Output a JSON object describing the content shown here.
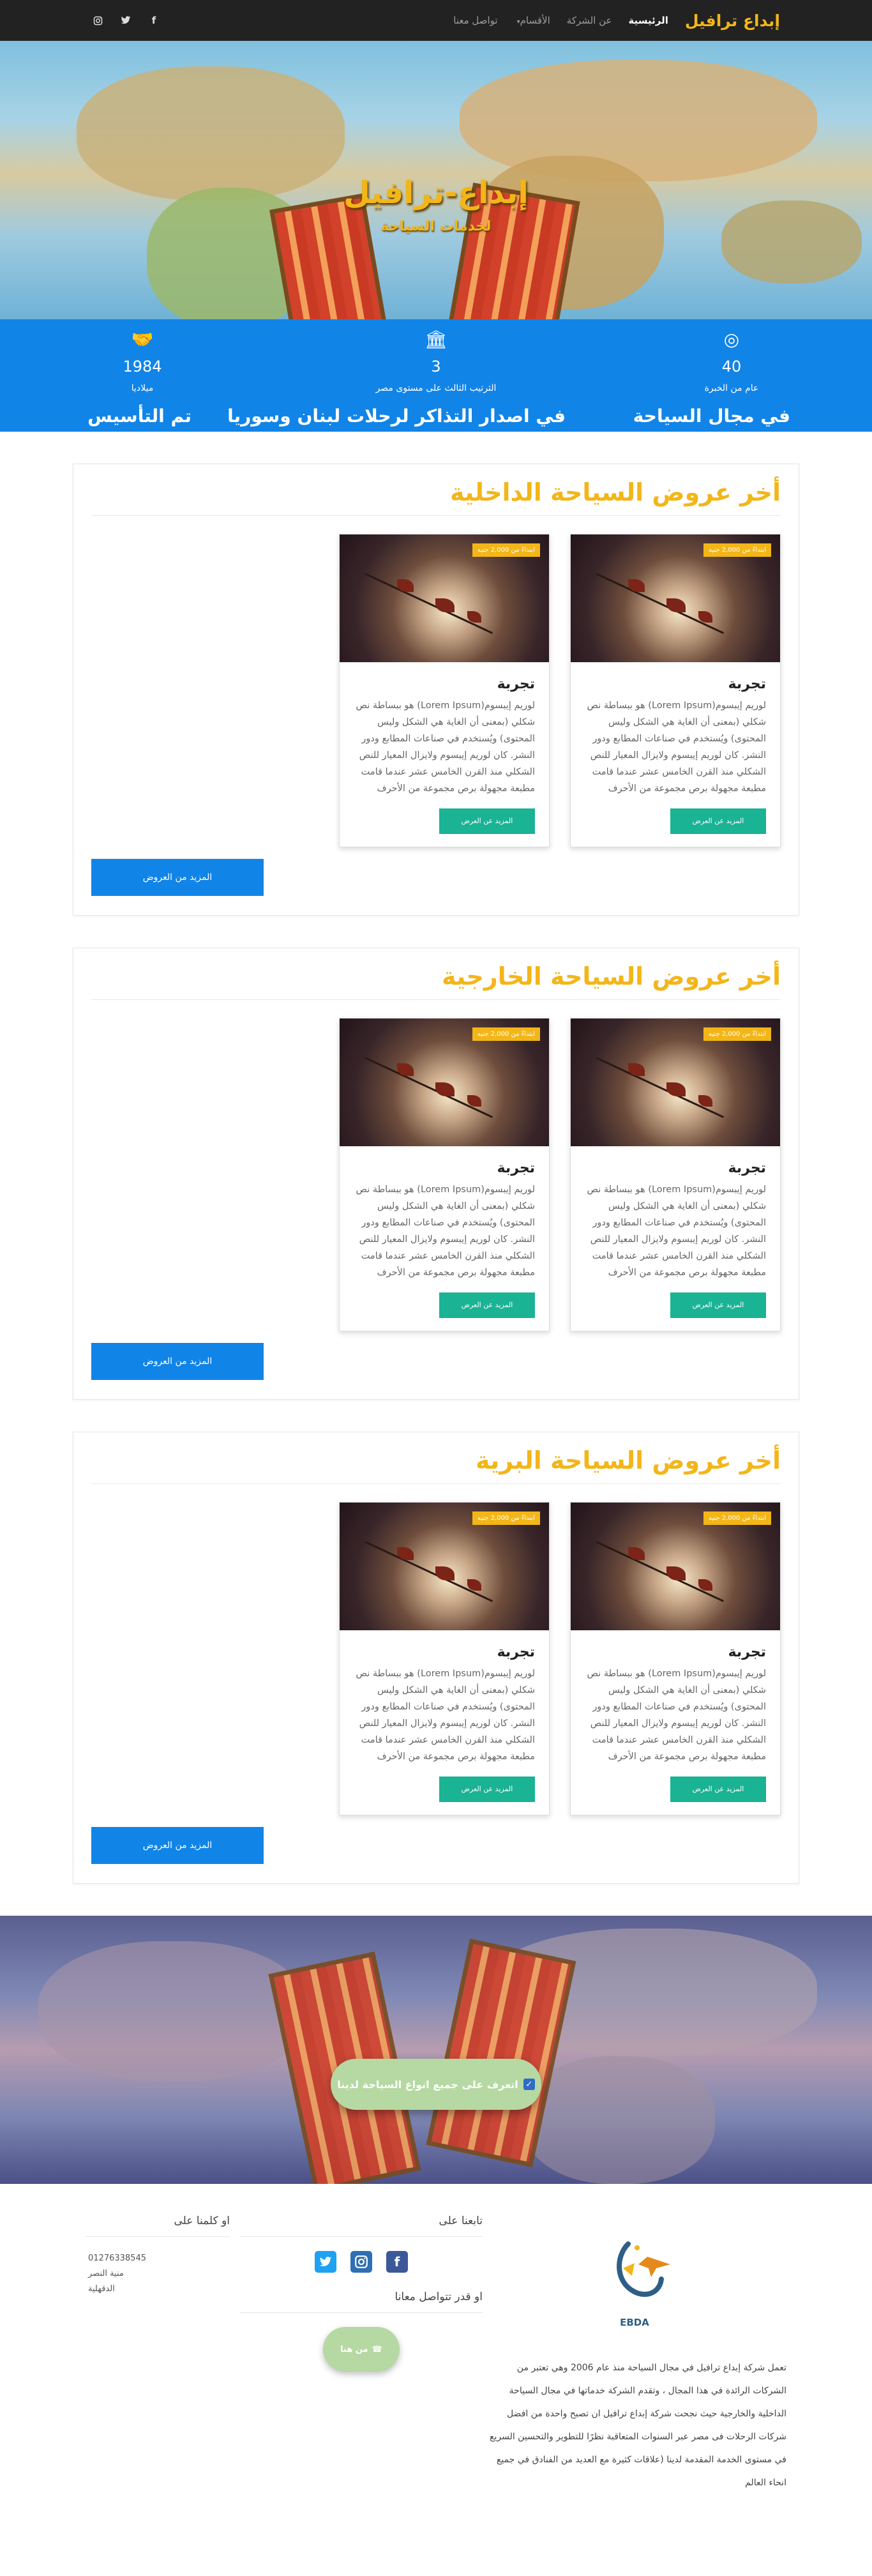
{
  "nav": {
    "brand": "إبداع ترافيل",
    "links": [
      "الرئيسية",
      "عن الشركة",
      "الأقسام",
      "تواصل معنا"
    ],
    "dropdown_caret": "▾"
  },
  "hero": {
    "title": "إبداع-ترافيل",
    "subtitle": "لخدمات السياحة"
  },
  "stats": [
    {
      "icon": "target-icon",
      "glyph": "◎",
      "number": "40",
      "label": "عام من الخبرة",
      "headline": "في مجال السياحة"
    },
    {
      "icon": "bank-icon",
      "glyph": "🏛",
      "number": "3",
      "label": "الثرتيب الثالث على مستوى مصر",
      "headline": "في اصدار التذاكر لرحلات لبنان وسوريا"
    },
    {
      "icon": "handshake-icon",
      "glyph": "🤝",
      "number": "1984",
      "label": "ميلاديا",
      "headline": "تم التأسيس"
    }
  ],
  "card_common": {
    "badge": "ابتداءً من 2,000 جنيه",
    "title": "تجربة",
    "text": "لوريم إيبسوم(Lorem Ipsum) هو ببساطة نص شكلي (بمعنى أن الغاية هي الشكل وليس المحتوى) ويُستخدم في صناعات المطابع ودور النشر. كان لوريم إيبسوم ولايزال المعيار للنص الشكلي منذ القرن الخامس عشر عندما قامت مطبعة مجهولة برص مجموعة من الأحرف",
    "button": "المزيد عن العرض"
  },
  "sections": [
    {
      "title": "أخر عروض السياحة الداخلية",
      "more": "المزيد من العروض"
    },
    {
      "title": "أخر عروض السياحة الخارجية",
      "more": "المزيد من العروض"
    },
    {
      "title": "أخر عروض السياحة البرية",
      "more": "المزيد من العروض"
    }
  ],
  "banner": {
    "button": "اتعرف على جميع انواع السياحة لدينا",
    "check": "✓"
  },
  "footer": {
    "logo_text": "EBDA",
    "about": "تعمل شركة إبداع ترافيل في مجال السياحة منذ عام 2006 وهي تعتبر من الشركات الرائدة في هذا المجال ، وتقدم الشركة خدماتها في مجال السياحة الداخلية والخارجية حيث نجحت شركة إبداع ترافيل ان تصبح واحدة من افضل شركات الرحلات فى مصر عبر السنوات المتعاقبة نظرًا للتطوير والتحسين السريع في مستوى الخدمة المقدمة لدينا (علاقات كثيرة مع العديد من الفنادق في جميع انحاء العالم",
    "follow_heading": "تابعنا على",
    "contact_heading": "او قدر تتواصل معانا",
    "contact_button": "من هنا",
    "call_heading": "او كلمنا على",
    "phone": "01276338545",
    "city": "منية النصر",
    "region": "الدقهلية"
  },
  "colors": {
    "accent_yellow": "#f3b619",
    "primary_blue": "#1184e8",
    "teal": "#1ab394",
    "navbar": "#222222"
  }
}
